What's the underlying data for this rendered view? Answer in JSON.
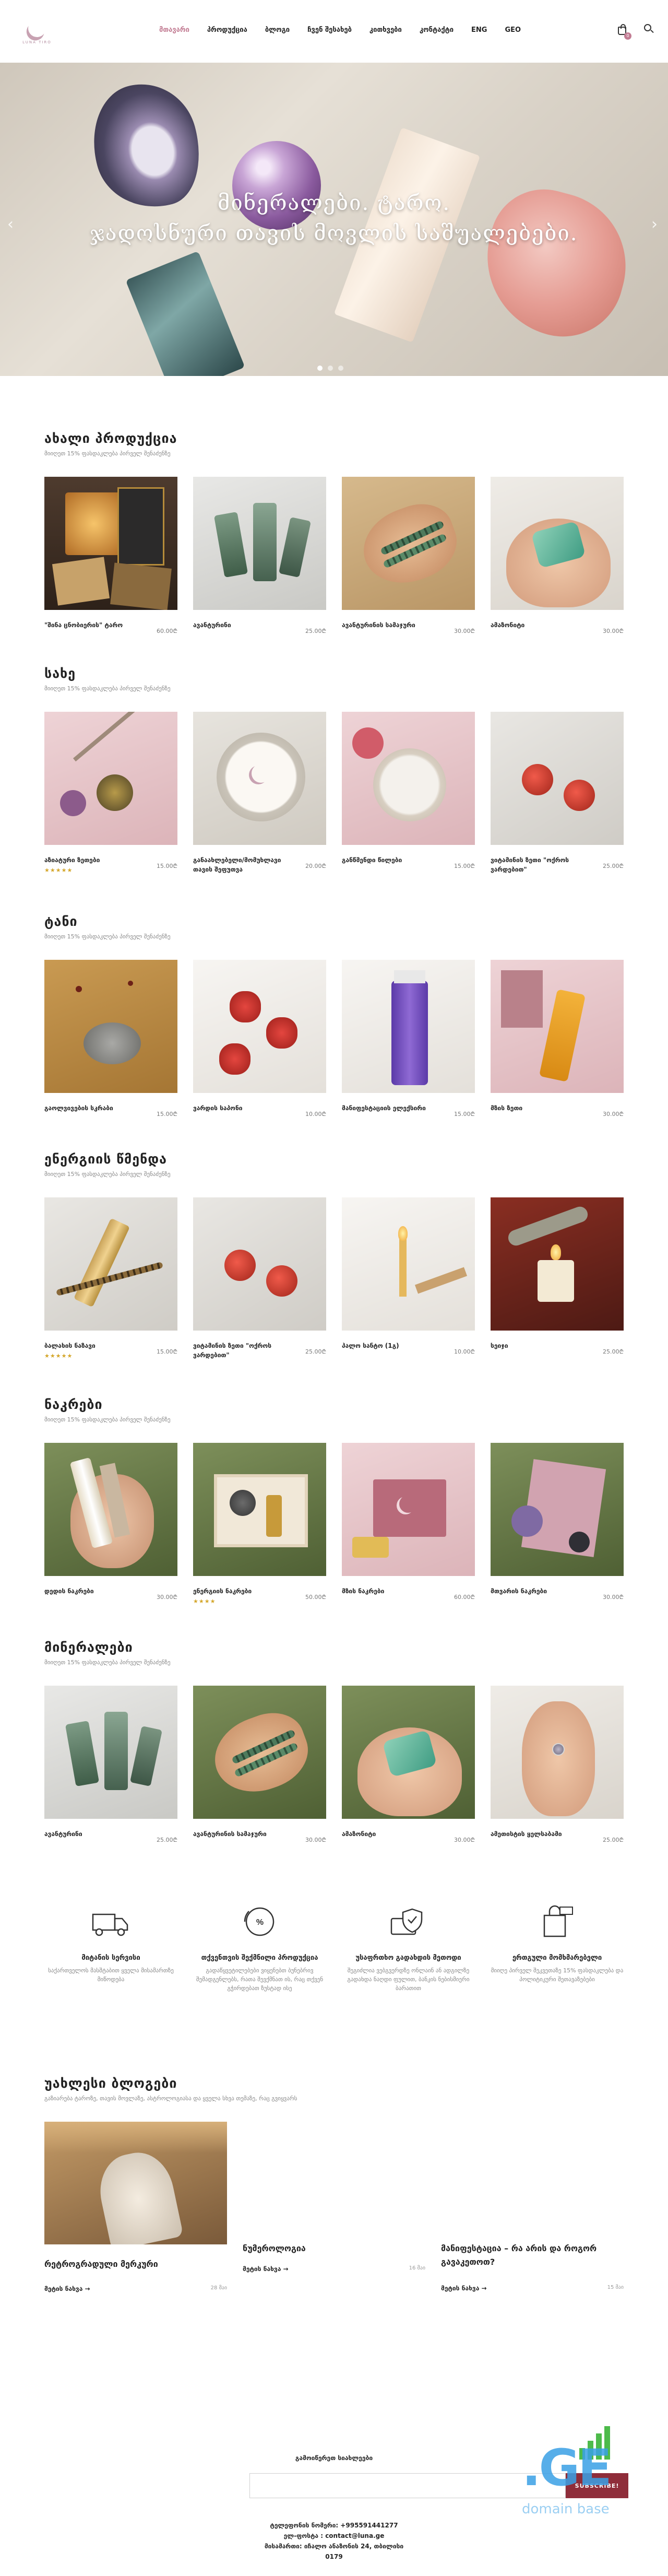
{
  "header": {
    "logo_text": "LUNA TIRO",
    "nav": [
      {
        "label": "მთავარი",
        "active": true
      },
      {
        "label": "პროდუქცია"
      },
      {
        "label": "ბლოგი"
      },
      {
        "label": "ჩვენ შესახებ"
      },
      {
        "label": "კითხვები"
      },
      {
        "label": "კონტაქტი"
      },
      {
        "label": "ENG"
      },
      {
        "label": "GEO"
      }
    ],
    "cart_count": "0"
  },
  "hero": {
    "title_line1": "მინერალები. ტარო.",
    "title_line2": "ჯადოსნური თავის მოვლის საშუალებები.",
    "arrow_left": "‹",
    "arrow_right": "›"
  },
  "sections": [
    {
      "title": "ახალი პროდუქცია",
      "subtitle": "მიიღეთ 15% ფასდაკლება პირველ შენაძენზე",
      "products": [
        {
          "name": "\"შინა ცნობიერის\" ტარო",
          "price": "60.00₾"
        },
        {
          "name": "ავანტურინი",
          "price": "25.00₾"
        },
        {
          "name": "ავანტურინის სამაჯური",
          "price": "30.00₾"
        },
        {
          "name": "ამაზონიტი",
          "price": "30.00₾"
        }
      ]
    },
    {
      "title": "სახე",
      "subtitle": "მიიღეთ 15% ფასდაკლება პირველ შენაძენზე",
      "products": [
        {
          "name": "აზიატური ზეთები",
          "price": "15.00₾",
          "stars": "★★★★★"
        },
        {
          "name": "განაახლებელი/მომუხლავი თავის შეფუთვა",
          "price": "20.00₾"
        },
        {
          "name": "განწმენდი წილები",
          "price": "15.00₾"
        },
        {
          "name": "ვიტამინის ზეთი \"ოქროს ვარდებით\"",
          "price": "25.00₾"
        }
      ]
    },
    {
      "title": "ტანი",
      "subtitle": "მიიღეთ 15% ფასდაკლება პირველ შენაძენზე",
      "products": [
        {
          "name": "გაოლვივების სკრაბი",
          "price": "15.00₾"
        },
        {
          "name": "ვარდის საპონი",
          "price": "10.00₾"
        },
        {
          "name": "მანიფესტაციის ელექსირი",
          "price": "15.00₾"
        },
        {
          "name": "მზის ზეთი",
          "price": "30.00₾"
        }
      ]
    },
    {
      "title": "ენერგიის წმენდა",
      "subtitle": "მიიღეთ 15% ფასდაკლება პირველ შენაძენზე",
      "products": [
        {
          "name": "ბალახის ნაზავი",
          "price": "15.00₾",
          "stars": "★★★★★"
        },
        {
          "name": "ვიტამინის ზეთი \"ოქროს ვარდებით\"",
          "price": "25.00₾"
        },
        {
          "name": "პალო სანტო (1გ)",
          "price": "10.00₾"
        },
        {
          "name": "სეიჯი",
          "price": "25.00₾"
        }
      ]
    },
    {
      "title": "ნაკრები",
      "subtitle": "მიიღეთ 15% ფასდაკლება პირველ შენაძენზე",
      "products": [
        {
          "name": "დედის ნაკრები",
          "price": "30.00₾"
        },
        {
          "name": "ენერგიის ნაკრები",
          "price": "50.00₾",
          "stars": "★★★★"
        },
        {
          "name": "მზის ნაკრები",
          "price": "60.00₾"
        },
        {
          "name": "მთვარის ნაკრები",
          "price": "30.00₾"
        }
      ]
    },
    {
      "title": "მინერალები",
      "subtitle": "მიიღეთ 15% ფასდაკლება პირველ შენაძენზე",
      "products": [
        {
          "name": "ავანტურინი",
          "price": "25.00₾"
        },
        {
          "name": "ავანტურინის სამაჯური",
          "price": "30.00₾"
        },
        {
          "name": "ამაზონიტი",
          "price": "30.00₾"
        },
        {
          "name": "ამეთისტის ყელსაბამი",
          "price": "25.00₾"
        }
      ]
    }
  ],
  "features": [
    {
      "title": "მიტანის სერვისი",
      "text": "საქართველოს მასშტაბით ყველა მისამართზე მიწოდება"
    },
    {
      "title": "თქვენთვის შექმნილი პროდუქცია",
      "text": "გადაწყვეტილებები ვიყენებთ ბუნებრივ შემადგენლებს, რათა შევქმნათ ის, რაც თქვენ გჭირდებათ ზუსტად ისე"
    },
    {
      "title": "უსაფრთხო გადახდის მეთოდი",
      "text": "შეგიძლია ვებგვერდზე ონლაინ ან ადგილზე გადახდა ნაღდი ფულით, ბანკის ნებისმიერი ბარათით"
    },
    {
      "title": "ერთგული მომხმარებელი",
      "text": "მიიღე პირველ შეკვეთაზე 15% ფასდაკლება და პოლიტიკური შეთავაზებები"
    }
  ],
  "blog": {
    "title": "უახლესი ბლოგები",
    "subtitle": "გაზიარება ტაროზე, თავის მოვლაზე, ასტროლოგიასა და ყველა სხვა თემაზე, რაც გვიყვარს",
    "posts": [
      {
        "title": "რეტროგრადული მერკური",
        "more": "მეტის ნახვა →",
        "date": "28 მაი"
      },
      {
        "title": "ნუმეროლოგია",
        "more": "მეტის ნახვა →",
        "date": "16 მაი"
      },
      {
        "title": "მანიფესტაცია – რა არის და როგორ გავაკეთოთ?",
        "more": "მეტის ნახვა →",
        "date": "15 მაი"
      }
    ]
  },
  "footer": {
    "newsletter_label": "გამოიწერეთ სიახლეები",
    "email_placeholder": "",
    "subscribe_label": "SUBSCRIBE!",
    "phone": "ტელეფონის ნომერი: +995591441277",
    "email": "ელ-ფოსტა : contact@luna.ge",
    "address_line1": "მისამართი: იჩალო ანაზონის 24, თბილისი",
    "address_line2": "0179"
  },
  "watermark": {
    "brand": ".GE",
    "caption": "domain base"
  },
  "colors": {
    "accent": "#c27c93",
    "subscribe_bg": "#8f2d3a",
    "star": "#d4a62a"
  }
}
